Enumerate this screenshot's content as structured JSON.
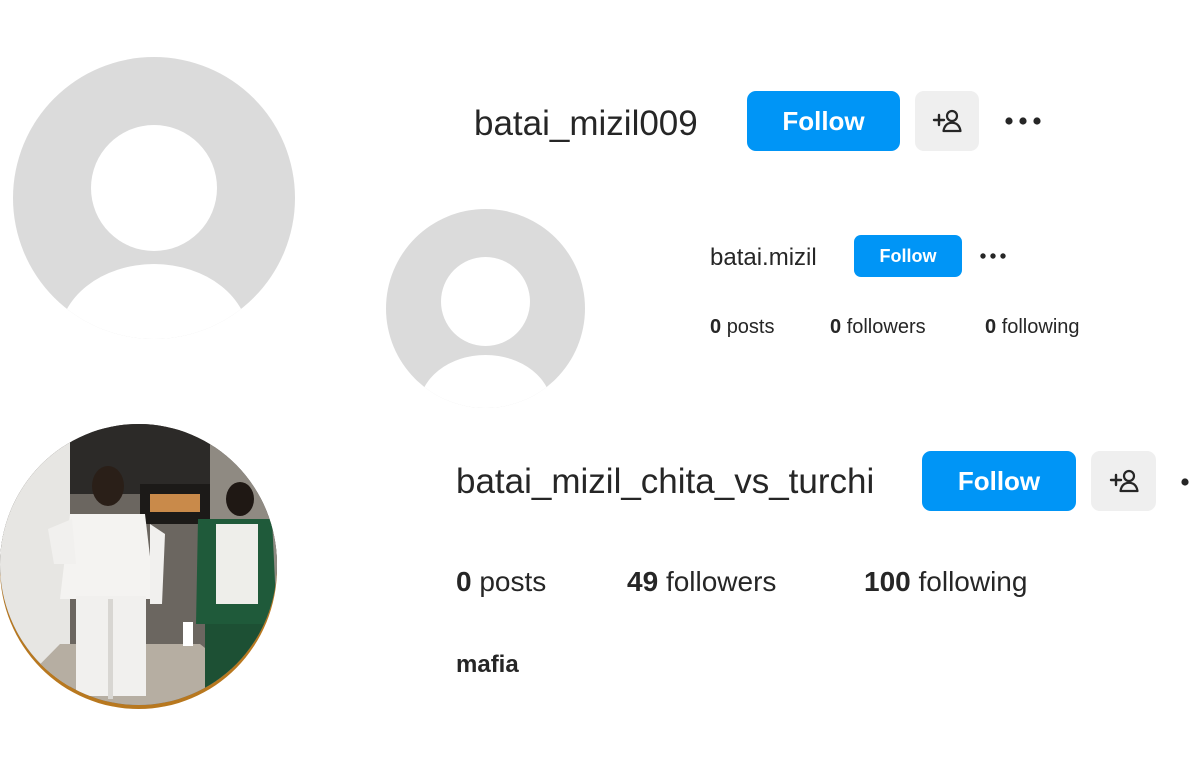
{
  "profile1": {
    "username": "batai_mizil009",
    "follow_label": "Follow",
    "suggest_icon": "add-person-icon",
    "more_icon": "more-dots-icon"
  },
  "profile2": {
    "username": "batai.mizil",
    "follow_label": "Follow",
    "more_icon": "more-dots-icon",
    "stats": {
      "posts_count": "0",
      "posts_label": "posts",
      "followers_count": "0",
      "followers_label": "followers",
      "following_count": "0",
      "following_label": "following"
    }
  },
  "profile3": {
    "username": "batai_mizil_chita_vs_turchi",
    "follow_label": "Follow",
    "suggest_icon": "add-person-icon",
    "more_icon": "more-dots-icon",
    "stats": {
      "posts_count": "0",
      "posts_label": "posts",
      "followers_count": "49",
      "followers_label": "followers",
      "following_count": "100",
      "following_label": "following"
    },
    "bio": "mafia"
  },
  "colors": {
    "accent": "#0095f6",
    "avatar_placeholder": "#dbdbdb",
    "secondary_button": "#efefef",
    "text": "#262626"
  }
}
